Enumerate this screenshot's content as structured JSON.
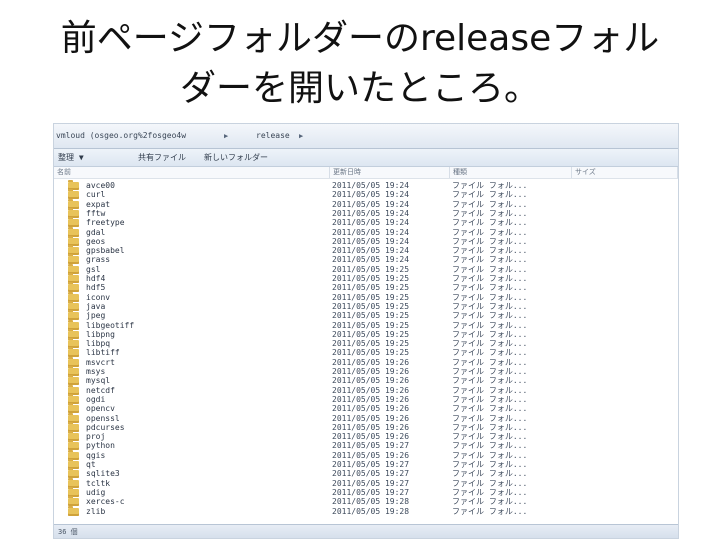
{
  "slide": {
    "title_line1": "前ページフォルダーのreleaseフォル",
    "title_line2": "ダーを開いたところ。"
  },
  "explorer": {
    "address_path": "vmloud (osgeo.org%2fosgeo4w",
    "address_release": "release",
    "toolbar": {
      "organize": "整理 ▼",
      "share": "共有ファイル",
      "new_folder": "新しいフォルダー"
    },
    "columns": {
      "name": "名前",
      "date": "更新日時",
      "type": "種類",
      "size": "サイズ"
    },
    "items": [
      {
        "name": "avce00",
        "date": "2011/05/05 19:24",
        "type": "ファイル フォル..."
      },
      {
        "name": "curl",
        "date": "2011/05/05 19:24",
        "type": "ファイル フォル..."
      },
      {
        "name": "expat",
        "date": "2011/05/05 19:24",
        "type": "ファイル フォル..."
      },
      {
        "name": "fftw",
        "date": "2011/05/05 19:24",
        "type": "ファイル フォル..."
      },
      {
        "name": "freetype",
        "date": "2011/05/05 19:24",
        "type": "ファイル フォル..."
      },
      {
        "name": "gdal",
        "date": "2011/05/05 19:24",
        "type": "ファイル フォル..."
      },
      {
        "name": "geos",
        "date": "2011/05/05 19:24",
        "type": "ファイル フォル..."
      },
      {
        "name": "gpsbabel",
        "date": "2011/05/05 19:24",
        "type": "ファイル フォル..."
      },
      {
        "name": "grass",
        "date": "2011/05/05 19:24",
        "type": "ファイル フォル..."
      },
      {
        "name": "gsl",
        "date": "2011/05/05 19:25",
        "type": "ファイル フォル..."
      },
      {
        "name": "hdf4",
        "date": "2011/05/05 19:25",
        "type": "ファイル フォル..."
      },
      {
        "name": "hdf5",
        "date": "2011/05/05 19:25",
        "type": "ファイル フォル..."
      },
      {
        "name": "iconv",
        "date": "2011/05/05 19:25",
        "type": "ファイル フォル..."
      },
      {
        "name": "java",
        "date": "2011/05/05 19:25",
        "type": "ファイル フォル..."
      },
      {
        "name": "jpeg",
        "date": "2011/05/05 19:25",
        "type": "ファイル フォル..."
      },
      {
        "name": "libgeotiff",
        "date": "2011/05/05 19:25",
        "type": "ファイル フォル..."
      },
      {
        "name": "libpng",
        "date": "2011/05/05 19:25",
        "type": "ファイル フォル..."
      },
      {
        "name": "libpq",
        "date": "2011/05/05 19:25",
        "type": "ファイル フォル..."
      },
      {
        "name": "libtiff",
        "date": "2011/05/05 19:25",
        "type": "ファイル フォル..."
      },
      {
        "name": "msvcrt",
        "date": "2011/05/05 19:26",
        "type": "ファイル フォル..."
      },
      {
        "name": "msys",
        "date": "2011/05/05 19:26",
        "type": "ファイル フォル..."
      },
      {
        "name": "mysql",
        "date": "2011/05/05 19:26",
        "type": "ファイル フォル..."
      },
      {
        "name": "netcdf",
        "date": "2011/05/05 19:26",
        "type": "ファイル フォル..."
      },
      {
        "name": "ogdi",
        "date": "2011/05/05 19:26",
        "type": "ファイル フォル..."
      },
      {
        "name": "opencv",
        "date": "2011/05/05 19:26",
        "type": "ファイル フォル..."
      },
      {
        "name": "openssl",
        "date": "2011/05/05 19:26",
        "type": "ファイル フォル..."
      },
      {
        "name": "pdcurses",
        "date": "2011/05/05 19:26",
        "type": "ファイル フォル..."
      },
      {
        "name": "proj",
        "date": "2011/05/05 19:26",
        "type": "ファイル フォル..."
      },
      {
        "name": "python",
        "date": "2011/05/05 19:27",
        "type": "ファイル フォル..."
      },
      {
        "name": "qgis",
        "date": "2011/05/05 19:26",
        "type": "ファイル フォル..."
      },
      {
        "name": "qt",
        "date": "2011/05/05 19:27",
        "type": "ファイル フォル..."
      },
      {
        "name": "sqlite3",
        "date": "2011/05/05 19:27",
        "type": "ファイル フォル..."
      },
      {
        "name": "tcltk",
        "date": "2011/05/05 19:27",
        "type": "ファイル フォル..."
      },
      {
        "name": "udig",
        "date": "2011/05/05 19:27",
        "type": "ファイル フォル..."
      },
      {
        "name": "xerces-c",
        "date": "2011/05/05 19:28",
        "type": "ファイル フォル..."
      },
      {
        "name": "zlib",
        "date": "2011/05/05 19:28",
        "type": "ファイル フォル..."
      }
    ],
    "status": "36 個"
  },
  "icons": {
    "folder": "folder-icon",
    "arrow": "chevron-right-icon"
  },
  "colors": {
    "folder": "#e8c35a",
    "toolbar_bg": "#dde6f1"
  }
}
